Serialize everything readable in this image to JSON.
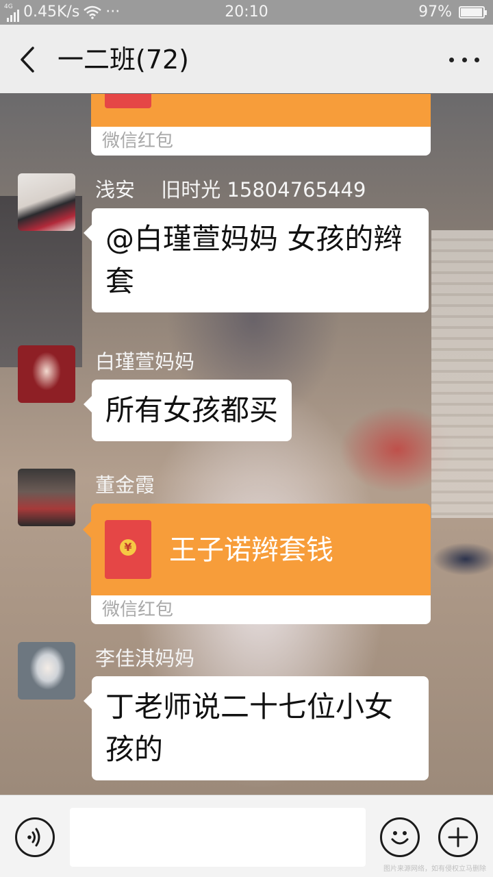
{
  "status_bar": {
    "network": "4G",
    "speed": "0.45K/s",
    "dots": "···",
    "time": "20:10",
    "battery": "97%"
  },
  "header": {
    "back_icon": "chevron-left-icon",
    "title": "一二班(72)",
    "more_icon": "more-horizontal-icon"
  },
  "messages": [
    {
      "type": "red_packet",
      "title": "",
      "footer": "微信红包"
    },
    {
      "type": "text",
      "sender": "浅安　 旧时光 15804765449",
      "text": "@白瑾萱妈妈  女孩的辫套"
    },
    {
      "type": "text",
      "sender": "白瑾萱妈妈",
      "text": "所有女孩都买"
    },
    {
      "type": "red_packet",
      "sender": "董金霞",
      "title": "王子诺辫套钱",
      "footer": "微信红包"
    },
    {
      "type": "text",
      "sender": "李佳淇妈妈",
      "text": "丁老师说二十七位小女孩的"
    }
  ],
  "input_bar": {
    "voice_icon": "voice-icon",
    "text_value": "",
    "emoji_icon": "emoji-icon",
    "plus_icon": "plus-icon"
  },
  "watermark": "图片来源网络，如有侵权立马删除",
  "colors": {
    "red_packet_orange": "#f79d3a",
    "envelope_red": "#e54646",
    "header_bg": "#ededed",
    "status_bar_bg": "#9b9b9b"
  }
}
